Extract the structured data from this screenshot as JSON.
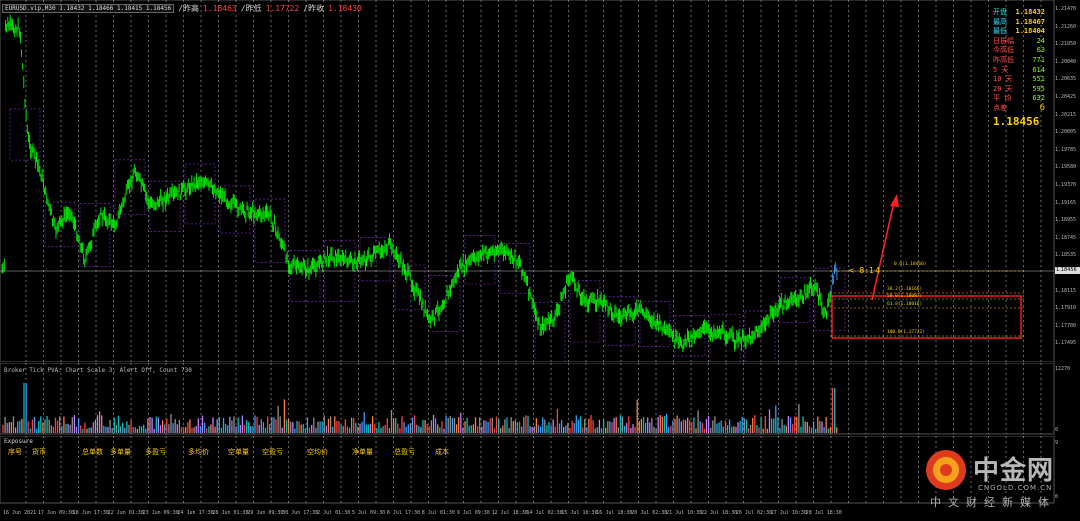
{
  "topbar": {
    "symbol": "EURUSD.vip,M30",
    "ohlc": "1.18432 1.18466 1.18415 1.18456",
    "prev_label": "/昨高",
    "prev_value": "1.18463",
    "low_label": "/昨低",
    "low_value": "1.17722",
    "close_label": "/昨收",
    "close_value": "1.18430"
  },
  "info_panel": {
    "rows": [
      {
        "k": "开盘",
        "v": "1.18432"
      },
      {
        "k": "最高",
        "v": "1.18467"
      },
      {
        "k": "最低",
        "v": "1.18404"
      },
      {
        "k": "日振幅",
        "v": "24"
      },
      {
        "k": "今高低",
        "v": "63"
      },
      {
        "k": "昨高低",
        "v": "771"
      },
      {
        "k": "5 天",
        "v": "614"
      },
      {
        "k": "10 天",
        "v": "551"
      },
      {
        "k": "20 天",
        "v": "595"
      },
      {
        "k": "平 均",
        "v": "632"
      },
      {
        "k": "点差",
        "v": "6"
      }
    ],
    "big_price": "1.18456"
  },
  "price_axis": [
    "1.21470",
    "1.21260",
    "1.21050",
    "1.20840",
    "1.20635",
    "1.20425",
    "1.20215",
    "1.20005",
    "1.19785",
    "1.19580",
    "1.19370",
    "1.19165",
    "1.18955",
    "1.18745",
    "1.18535",
    "1.18325",
    "1.18115",
    "1.17910",
    "1.17700",
    "1.17495"
  ],
  "current_price_tag": "1.18456",
  "ask_timer": "< 8:14",
  "fib_labels": [
    "0.0(1.18460)",
    "38.2(1.18166)",
    "50.0(1.18087)",
    "61.8(1.18016)",
    "100.0(1.17722)"
  ],
  "volume_indicator": {
    "title": "Broker Tick PVA:  Chart Scale 3,  Alert Off,  Count  730",
    "axis_top": "12270",
    "axis_bottom": "0"
  },
  "exposure": {
    "title": "Exposure",
    "columns": [
      "序号",
      "货币",
      "总单数",
      "多单量",
      "多盈亏",
      "多均价",
      "空单量",
      "空盈亏",
      "空均价",
      "净单量",
      "总盈亏",
      "成本"
    ],
    "axis_top": "9",
    "axis_bottom": "0"
  },
  "time_axis": [
    "16 Jun 2021",
    "17 Jun 09:30",
    "18 Jun 17:30",
    "22 Jun 01:30",
    "23 Jun 09:30",
    "24 Jun 17:30",
    "28 Jun 01:30",
    "29 Jun 09:30",
    "30 Jun 17:30",
    "2 Jul 01:30",
    "5 Jul 09:30",
    "6 Jul 17:30",
    "8 Jul 01:30",
    "9 Jul 09:30",
    "12 Jul 18:30",
    "14 Jul 02:30",
    "15 Jul 10:30",
    "16 Jul 18:30",
    "20 Jul 02:30",
    "21 Jul 10:30",
    "22 Jul 18:30",
    "26 Jul 02:30",
    "27 Jul 10:30",
    "28 Jul 18:30"
  ],
  "logo": {
    "name": "中金网",
    "url": "CNGOLD.COM.CN",
    "tagline": "中文财经新媒体"
  },
  "colors": {
    "background": "#000000",
    "candle": "#00ff00",
    "grid": "#ffffff",
    "box": "#8a2be2",
    "highlight_box": "#ff2020",
    "fib": "#ffcc00"
  }
}
